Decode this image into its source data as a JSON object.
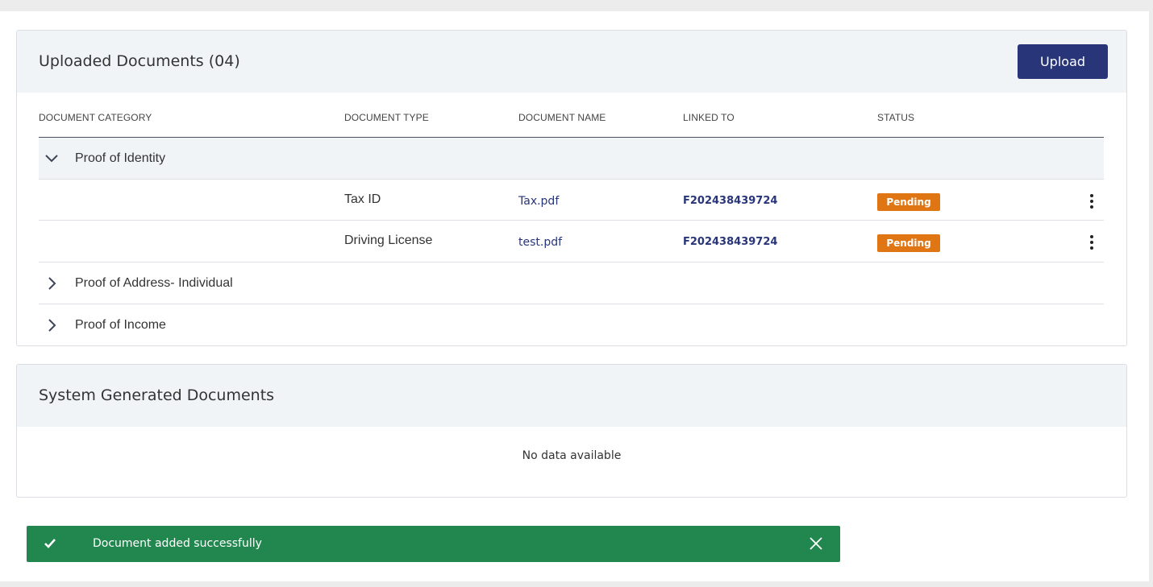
{
  "uploaded": {
    "title": "Uploaded Documents (04)",
    "upload_label": "Upload",
    "columns": [
      "DOCUMENT CATEGORY",
      "DOCUMENT TYPE",
      "DOCUMENT NAME",
      "LINKED TO",
      "STATUS"
    ],
    "categories": [
      {
        "label": "Proof of Identity",
        "expanded": true,
        "documents": [
          {
            "type": "Tax ID",
            "name": "Tax.pdf",
            "linked_to": "F202438439724",
            "status": "Pending"
          },
          {
            "type": "Driving License",
            "name": "test.pdf",
            "linked_to": "F202438439724",
            "status": "Pending"
          }
        ]
      },
      {
        "label": "Proof of Address- Individual",
        "expanded": false
      },
      {
        "label": "Proof of Income",
        "expanded": false
      }
    ]
  },
  "system": {
    "title": "System Generated Documents",
    "empty_text": "No data available"
  },
  "toast": {
    "message": "Document added successfully",
    "icon": "check-icon",
    "close_icon": "close-icon"
  },
  "colors": {
    "primary": "#283579",
    "pending": "#e07514",
    "success": "#22874f",
    "header_bg": "#f1f4f7"
  }
}
